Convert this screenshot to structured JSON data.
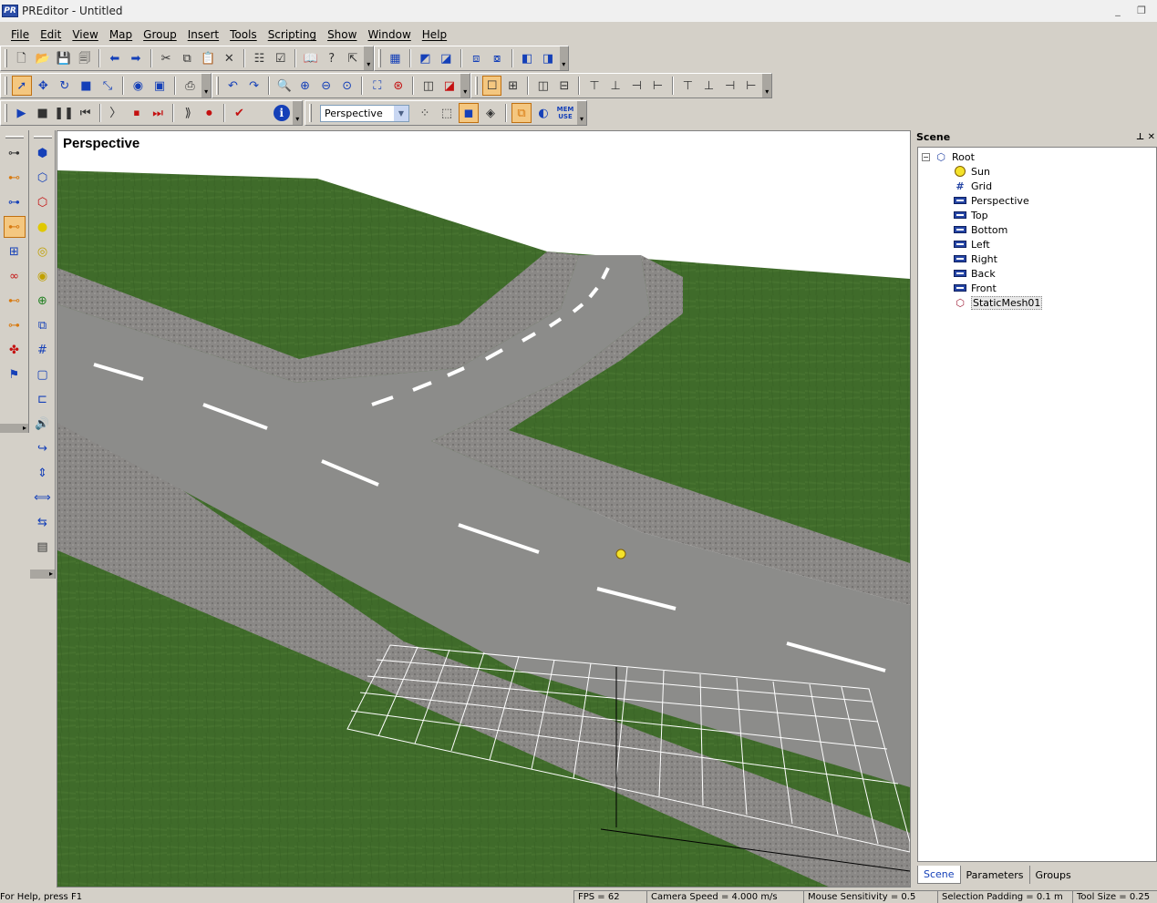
{
  "window": {
    "logo_text": "PR",
    "title": "PREditor - Untitled",
    "minimize": "_",
    "restore": "❐",
    "close": "✕"
  },
  "menu": [
    "File",
    "Edit",
    "View",
    "Map",
    "Group",
    "Insert",
    "Tools",
    "Scripting",
    "Show",
    "Window",
    "Help"
  ],
  "toolbar": {
    "view_select": "Perspective",
    "mem_label_top": "MEM",
    "mem_label_bottom": "USE",
    "info": "i"
  },
  "viewport": {
    "label": "Perspective"
  },
  "scene": {
    "title": "Scene",
    "pin": "📌",
    "close": "✕",
    "items": [
      {
        "label": "Root",
        "icon": "root-icon"
      },
      {
        "label": "Sun",
        "icon": "sun-icon"
      },
      {
        "label": "Grid",
        "icon": "grid-icon"
      },
      {
        "label": "Perspective",
        "icon": "camera-icon"
      },
      {
        "label": "Top",
        "icon": "camera-icon"
      },
      {
        "label": "Bottom",
        "icon": "camera-icon"
      },
      {
        "label": "Left",
        "icon": "camera-icon"
      },
      {
        "label": "Right",
        "icon": "camera-icon"
      },
      {
        "label": "Back",
        "icon": "camera-icon"
      },
      {
        "label": "Front",
        "icon": "camera-icon"
      },
      {
        "label": "StaticMesh01",
        "icon": "mesh-icon"
      }
    ],
    "tabs": [
      "Scene",
      "Parameters",
      "Groups"
    ]
  },
  "status": {
    "help": "For Help, press F1",
    "fps": "FPS = 62",
    "camera_speed": "Camera Speed = 4.000 m/s",
    "mouse_sensitivity": "Mouse Sensitivity = 0.5",
    "selection_padding": "Selection Padding = 0.1 m",
    "tool_size": "Tool Size = 0.25"
  },
  "colors": {
    "grass": "#3f6b2a",
    "road": "#8c8c8a",
    "curb": "#7a7a7a",
    "lane_marking": "#ffffff",
    "active_tool": "#f4c780"
  }
}
